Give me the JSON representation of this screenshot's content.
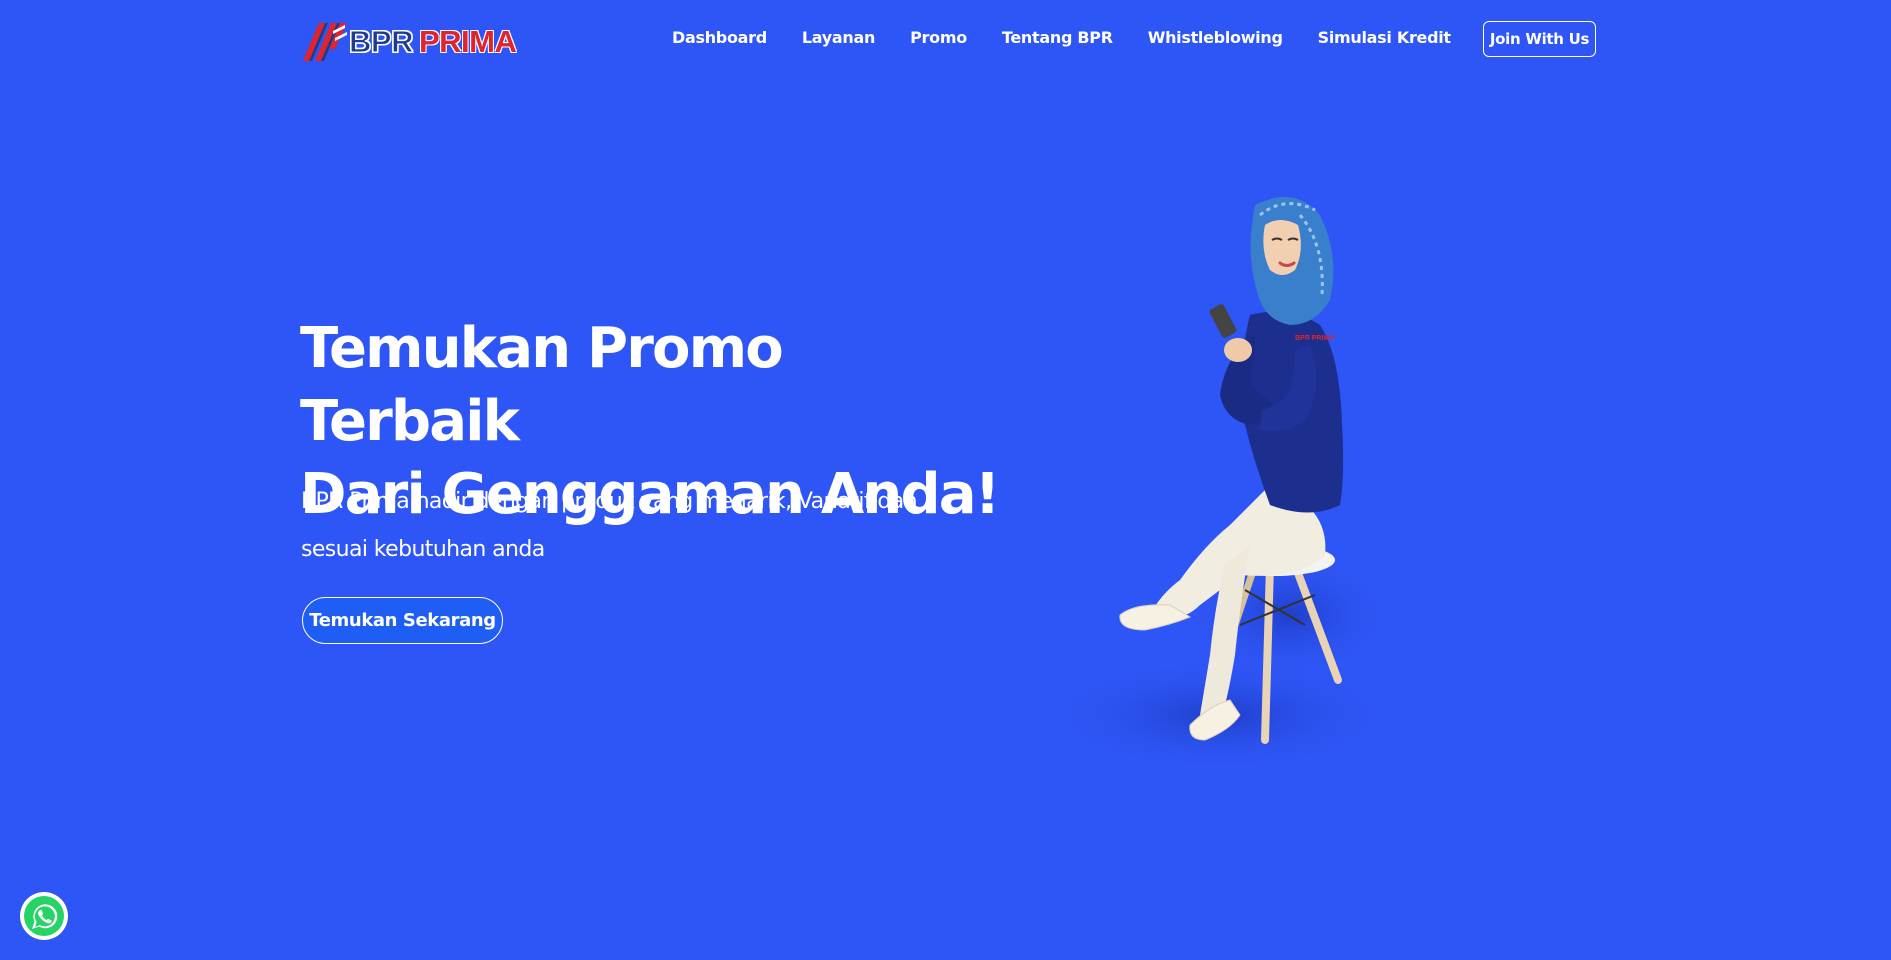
{
  "brand": {
    "logo_bpr": "BPR",
    "logo_prima": "PRIMA",
    "colors": {
      "background": "#2e55f5",
      "logo_navy": "#203a8f",
      "logo_red": "#e0242e",
      "cta_fill": "#1e5ef5",
      "whatsapp": "#25d366"
    }
  },
  "nav": {
    "items": [
      {
        "label": "Dashboard"
      },
      {
        "label": "Layanan"
      },
      {
        "label": "Promo"
      },
      {
        "label": "Tentang BPR"
      },
      {
        "label": "Whistleblowing"
      },
      {
        "label": "Simulasi Kredit"
      }
    ],
    "join_label": "Join With Us"
  },
  "hero": {
    "title_line1": "Temukan Promo Terbaik",
    "title_line2": "Dari Genggaman Anda!",
    "desc_line1": "BPR Prima hadir dengan produk yang menarik, Variatif dan",
    "desc_line2": "sesuai kebutuhan anda",
    "cta_label": "Temukan Sekarang",
    "logo_shirt": "BPR PRIMA"
  },
  "icons": {
    "logo": "bpr-prima-logo-icon",
    "whatsapp": "whatsapp-icon"
  }
}
